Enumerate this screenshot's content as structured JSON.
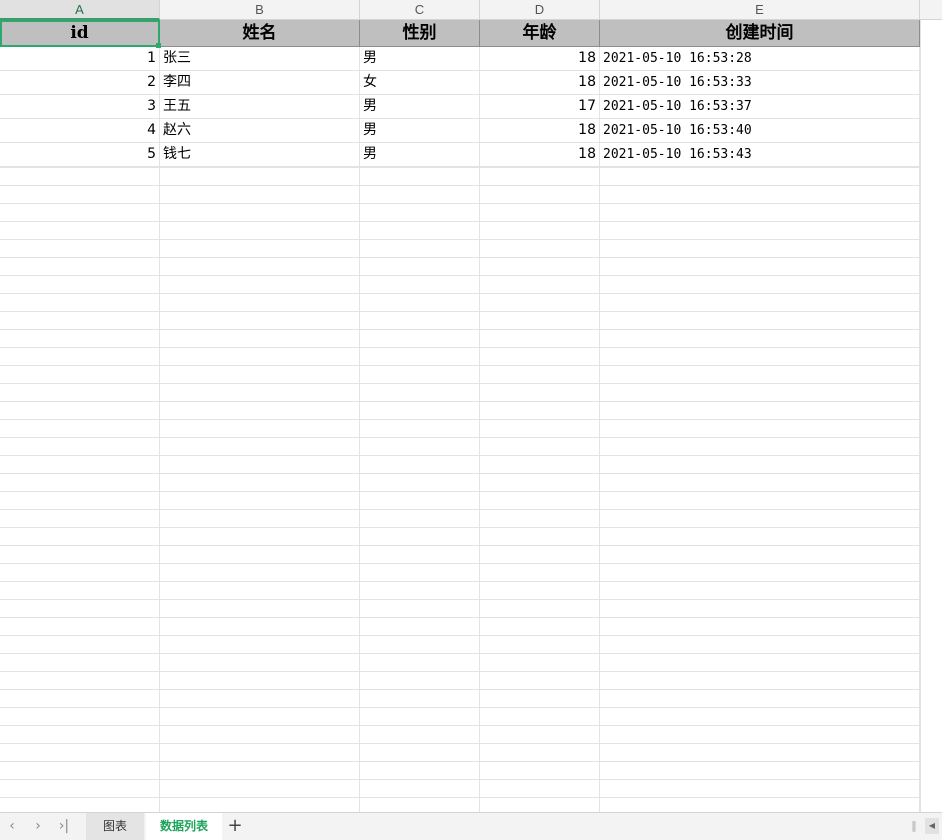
{
  "columns": [
    "A",
    "B",
    "C",
    "D",
    "E"
  ],
  "header": {
    "id": "id",
    "name": "姓名",
    "gender": "性别",
    "age": "年龄",
    "created": "创建时间"
  },
  "rows": [
    {
      "id": "1",
      "name": "张三",
      "gender": "男",
      "age": "18",
      "created": "2021-05-10 16:53:28"
    },
    {
      "id": "2",
      "name": "李四",
      "gender": "女",
      "age": "18",
      "created": "2021-05-10 16:53:33"
    },
    {
      "id": "3",
      "name": "王五",
      "gender": "男",
      "age": "17",
      "created": "2021-05-10 16:53:37"
    },
    {
      "id": "4",
      "name": "赵六",
      "gender": "男",
      "age": "18",
      "created": "2021-05-10 16:53:40"
    },
    {
      "id": "5",
      "name": "钱七",
      "gender": "男",
      "age": "18",
      "created": "2021-05-10 16:53:43"
    }
  ],
  "sheets": {
    "tab1": "图表",
    "tab2": "数据列表",
    "active": "数据列表"
  },
  "nav": {
    "prev": "‹",
    "next": "›",
    "last": "›|",
    "add": "+"
  },
  "colors": {
    "accent": "#2fa86d",
    "header_bg": "#bfbfbf",
    "active_tab_text": "#1fa35c"
  }
}
